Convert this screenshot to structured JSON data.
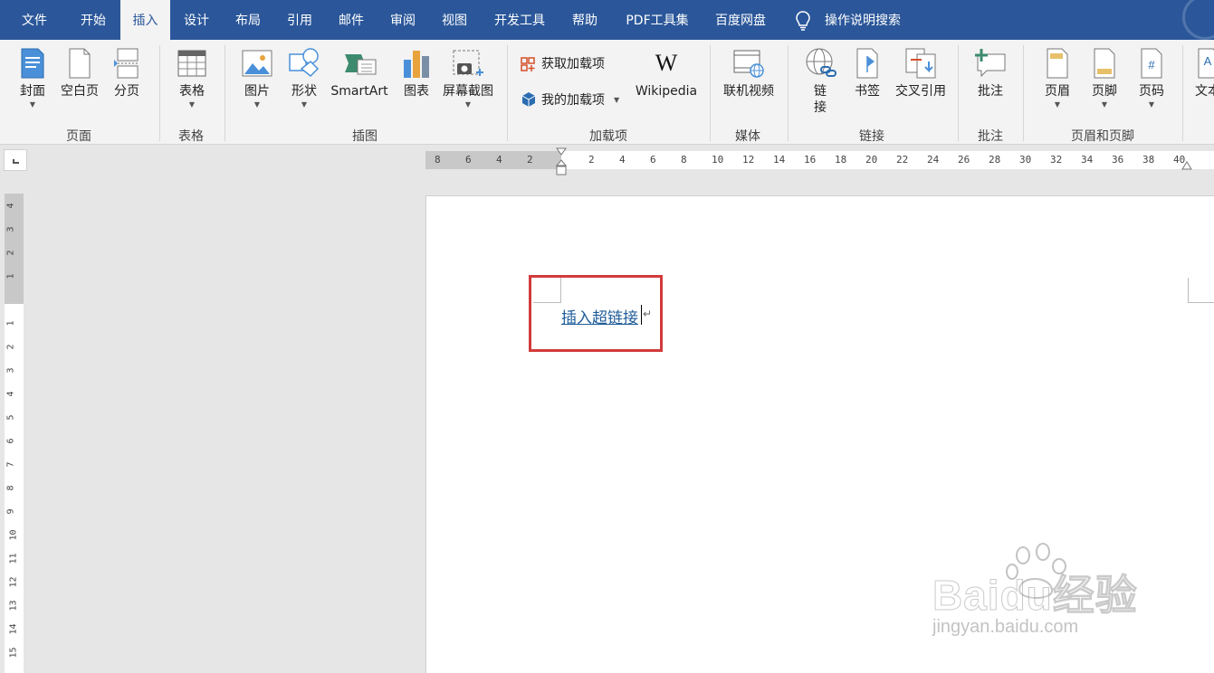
{
  "tabs": [
    "文件",
    "开始",
    "插入",
    "设计",
    "布局",
    "引用",
    "邮件",
    "审阅",
    "视图",
    "开发工具",
    "帮助",
    "PDF工具集",
    "百度网盘"
  ],
  "active_tab": "插入",
  "tell_me": "操作说明搜索",
  "ribbon": {
    "buttons": {
      "cover": "封面",
      "blank_page": "空白页",
      "page_break": "分页",
      "table": "表格",
      "picture": "图片",
      "shapes": "形状",
      "smartart": "SmartArt",
      "chart": "图表",
      "screenshot": "屏幕截图",
      "get_addins": "获取加载项",
      "my_addins": "我的加载项",
      "wikipedia": "Wikipedia",
      "online_video": "联机视频",
      "link_line1": "链",
      "link_line2": "接",
      "bookmark": "书签",
      "cross_ref": "交叉引用",
      "comment": "批注",
      "header": "页眉",
      "footer": "页脚",
      "page_number": "页码",
      "textbox": "文本"
    },
    "groups": {
      "pages": "页面",
      "tables": "表格",
      "illustrations": "插图",
      "addins": "加载项",
      "media": "媒体",
      "links": "链接",
      "comments": "批注",
      "header_footer": "页眉和页脚"
    }
  },
  "hruler_labels": [
    "8",
    "6",
    "4",
    "2",
    "2",
    "4",
    "6",
    "8",
    "10",
    "12",
    "14",
    "16",
    "18",
    "20",
    "22",
    "24",
    "26",
    "28",
    "30",
    "32",
    "34",
    "36",
    "38",
    "40"
  ],
  "vruler_labels": [
    "4",
    "3",
    "2",
    "1",
    "1",
    "2",
    "3",
    "4",
    "5",
    "6",
    "7",
    "8",
    "9",
    "10",
    "11",
    "12",
    "13",
    "14",
    "15"
  ],
  "document": {
    "hyperlink_text": "插入超链接",
    "paragraph_mark": "↵"
  },
  "watermark": {
    "brand": "Baidu经验",
    "url": "jingyan.baidu.com"
  },
  "colors": {
    "tabbar": "#2b579a",
    "hyperlink": "#1f5c99",
    "highlight_box": "#d23b3b"
  }
}
